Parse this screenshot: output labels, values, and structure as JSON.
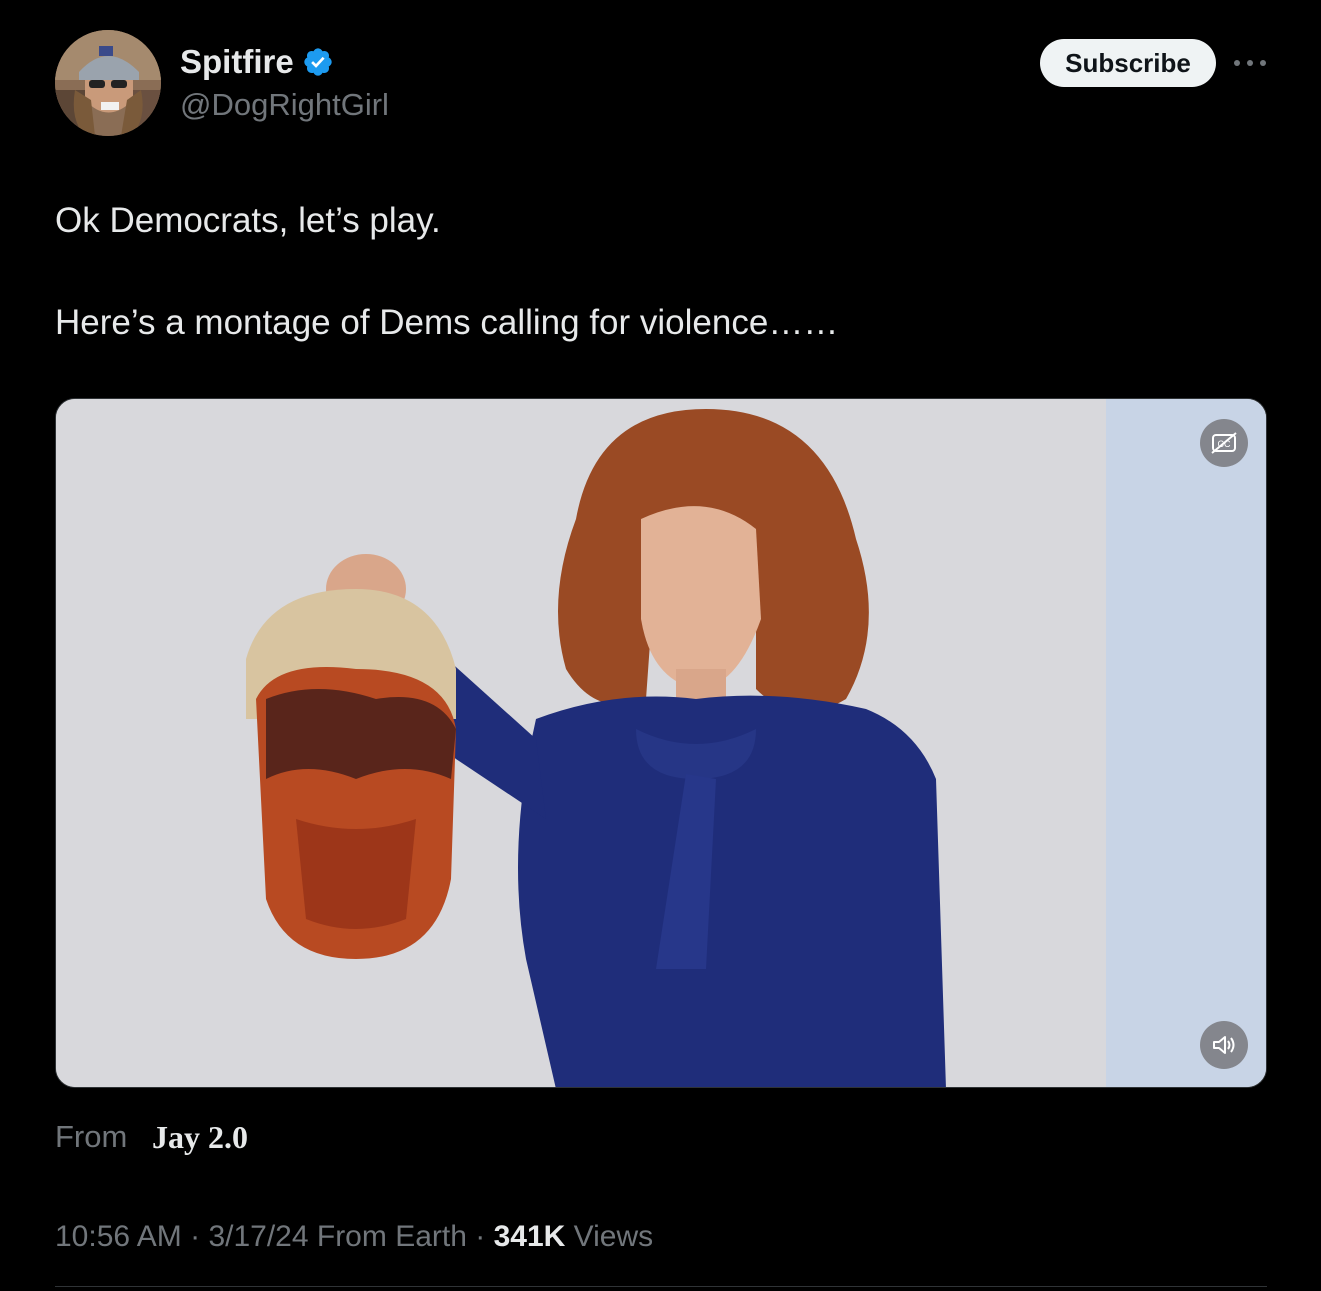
{
  "author": {
    "display_name": "Spitfire",
    "handle": "@DogRightGirl",
    "verified": true
  },
  "actions": {
    "subscribe_label": "Subscribe",
    "more_icon": "more-horizontal-icon"
  },
  "tweet": {
    "line1": "Ok Democrats, let’s play.",
    "line2": "Here’s a montage of Dems calling for violence……"
  },
  "media": {
    "type": "video",
    "captions_icon": "captions-off-icon",
    "mute_icon": "speaker-muted-icon"
  },
  "source": {
    "from_label": "From",
    "name": "Jay 2.0"
  },
  "meta": {
    "time": "10:56 AM",
    "sep1": " · ",
    "date": "3/17/24",
    "location": " From Earth",
    "sep2": " · ",
    "views_count": "341K",
    "views_label": " Views"
  },
  "colors": {
    "background": "#000000",
    "text_primary": "#e7e9ea",
    "text_secondary": "#71767b",
    "verified_blue": "#1d9bf0",
    "subscribe_bg": "#eff3f4"
  }
}
